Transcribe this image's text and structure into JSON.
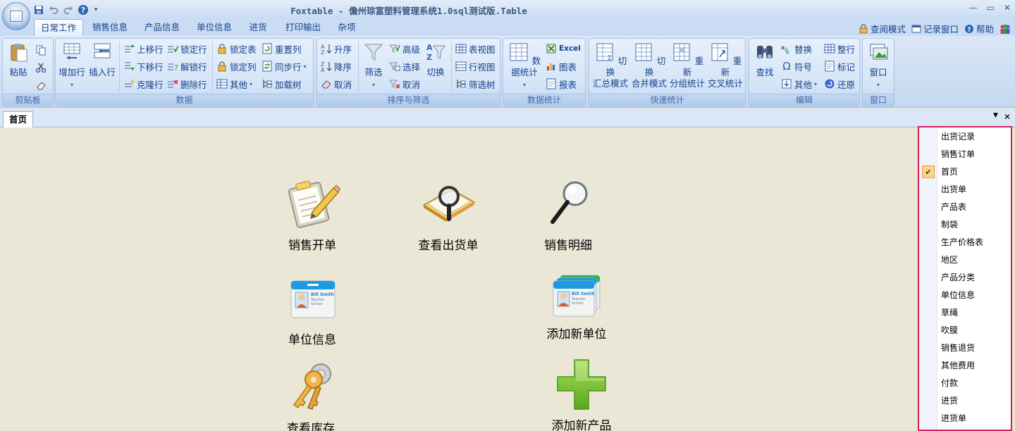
{
  "app": {
    "title": "Foxtable - 儋州琮富塑料管理系统1.0sql测试版.Table"
  },
  "window_controls": [
    "—",
    "▭",
    "✕"
  ],
  "ribbon_tabs": [
    {
      "label": "日常工作",
      "active": true
    },
    {
      "label": "销售信息"
    },
    {
      "label": "产品信息"
    },
    {
      "label": "单位信息"
    },
    {
      "label": "进货"
    },
    {
      "label": "打印输出"
    },
    {
      "label": "杂项"
    }
  ],
  "right_links": {
    "view_mode": "查阅模式",
    "record_window": "记录窗口",
    "help": "帮助"
  },
  "groups": {
    "clipboard": {
      "label": "剪贴板",
      "paste": "粘贴"
    },
    "data": {
      "label": "数据",
      "add_row": "增加行",
      "insert_row": "插入行",
      "move_up": "上移行",
      "move_down": "下移行",
      "clone_row": "克隆行",
      "lock_row": "锁定行",
      "unlock_row": "解锁行",
      "delete_row": "删除行",
      "lock_table": "锁定表",
      "lock_col": "锁定列",
      "other": "其他",
      "reset_col": "重置列",
      "sync_row": "同步行",
      "load_tree": "加载树"
    },
    "sort_filter": {
      "label": "排序与筛选",
      "asc": "升序",
      "desc": "降序",
      "cancel": "取消",
      "filter": "筛选",
      "advanced": "高级",
      "select": "选择",
      "cancel2": "取消",
      "toggle": "切换",
      "table_view": "表视图",
      "row_view": "行视图",
      "filter_tree": "筛选树"
    },
    "stats": {
      "label": "数据统计",
      "data_stats": "数据统计",
      "excel": "Excel",
      "chart": "图表",
      "report": "报表"
    },
    "quick_stats": {
      "label": "快速统计",
      "b1_l1": "切换",
      "b1_l2": "汇总模式",
      "b2_l1": "切换",
      "b2_l2": "合并模式",
      "b3_l1": "重新",
      "b3_l2": "分组统计",
      "b4_l1": "重新",
      "b4_l2": "交叉统计"
    },
    "edit": {
      "label": "编辑",
      "find": "查找",
      "replace": "替换",
      "symbol": "符号",
      "other": "其他",
      "whole_row": "整行",
      "mark": "标记",
      "restore": "还原"
    },
    "window": {
      "label": "窗口",
      "window": "窗口"
    }
  },
  "doc_tab": {
    "label": "首页"
  },
  "tiles": [
    {
      "label": "销售开单"
    },
    {
      "label": "查看出货单"
    },
    {
      "label": "销售明细"
    },
    {
      "label": "单位信息"
    },
    {
      "label": "添加新单位"
    },
    {
      "label": "查看库存"
    },
    {
      "label": "添加新产品"
    }
  ],
  "card_text": {
    "name": "Bill Smith",
    "line2": "Teacher",
    "line3": "School"
  },
  "menu": {
    "items": [
      {
        "label": "出货记录"
      },
      {
        "label": "销售订单"
      },
      {
        "label": "首页",
        "checked": true
      },
      {
        "label": "出货单"
      },
      {
        "label": "产品表"
      },
      {
        "label": "制袋"
      },
      {
        "label": "生产价格表"
      },
      {
        "label": "地区"
      },
      {
        "label": "产品分类"
      },
      {
        "label": "单位信息"
      },
      {
        "label": "草绳"
      },
      {
        "label": "吹膜"
      },
      {
        "label": "销售退货"
      },
      {
        "label": "其他费用"
      },
      {
        "label": "付款"
      },
      {
        "label": "进货"
      },
      {
        "label": "进货单"
      }
    ]
  },
  "colors": {
    "accent": "#15428b",
    "menu_border": "#d3215d",
    "background": "#ebe7d6",
    "check": "#fbd589"
  }
}
